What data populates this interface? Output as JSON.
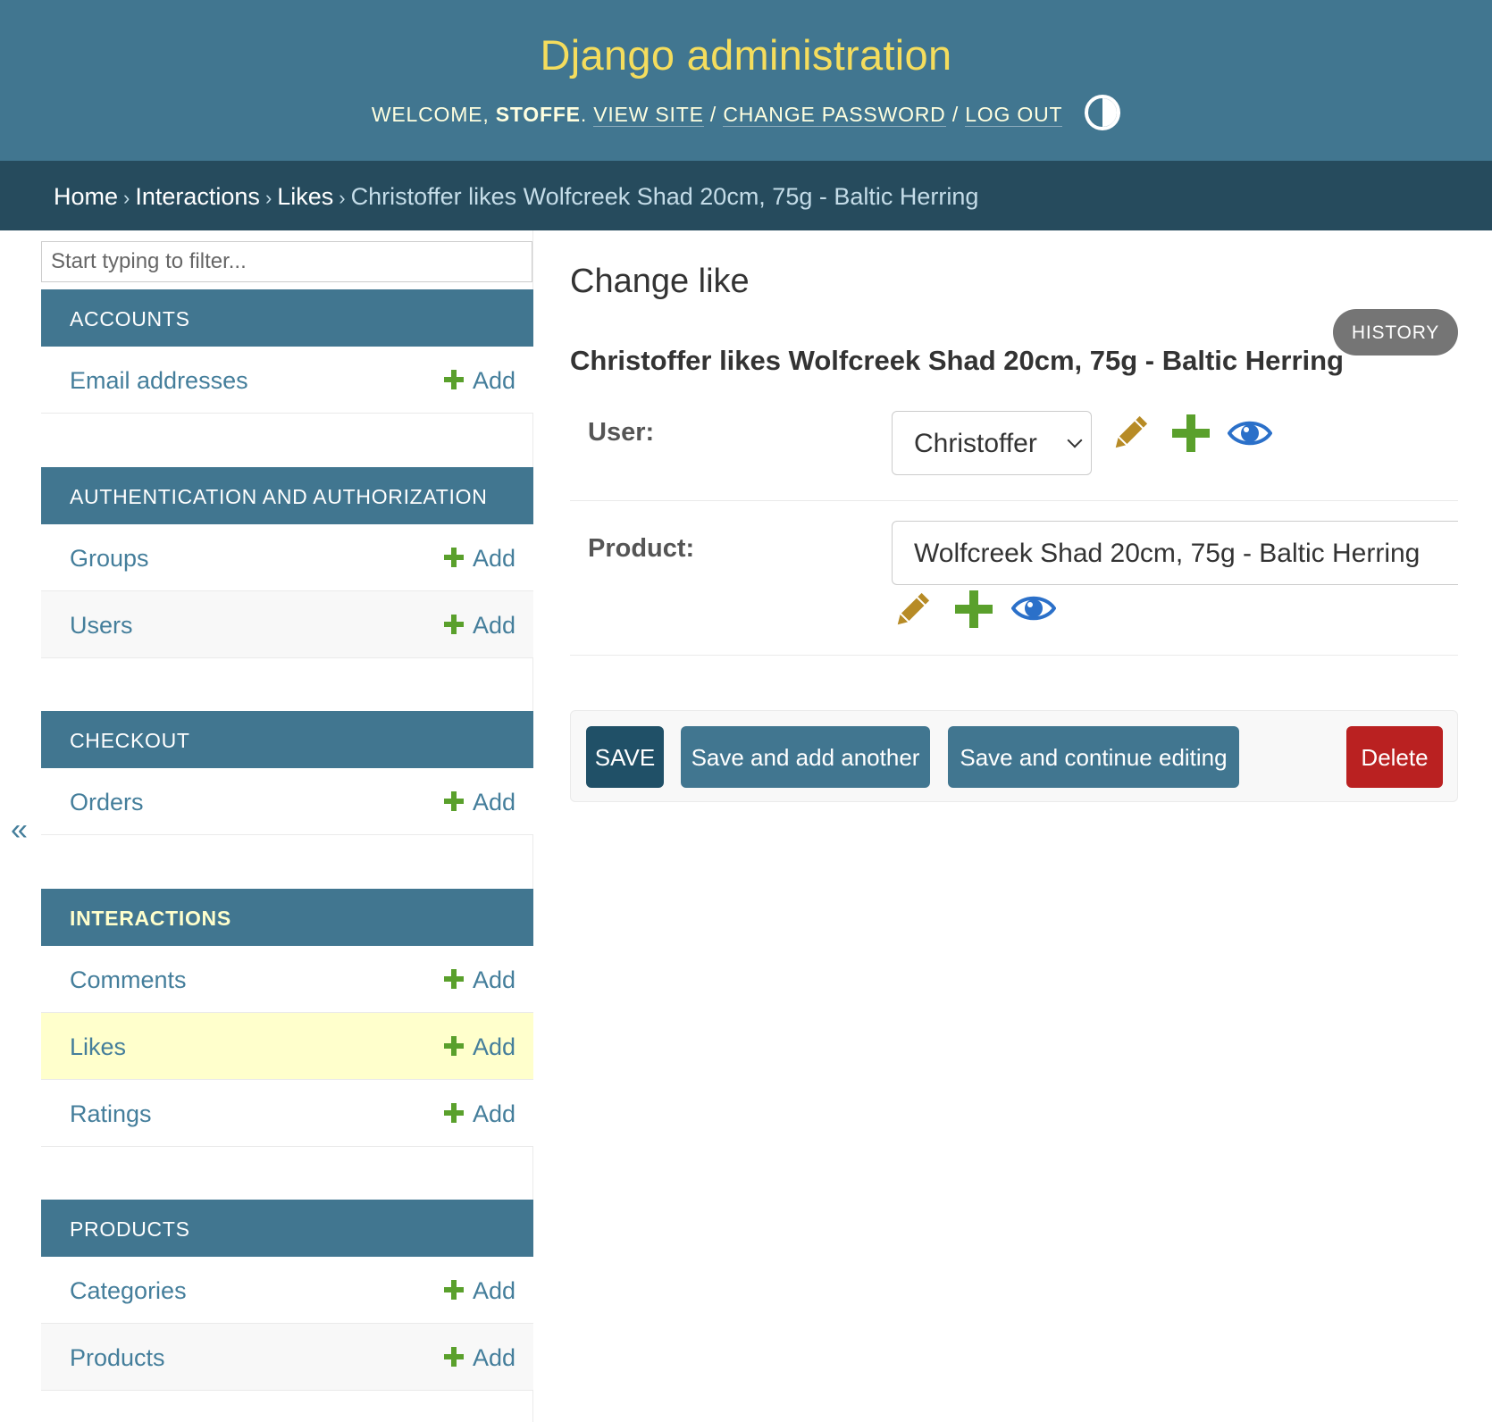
{
  "header": {
    "site_name": "Django administration",
    "welcome": "WELCOME,",
    "username": "STOFFE",
    "view_site": "VIEW SITE",
    "change_password": "CHANGE PASSWORD",
    "log_out": "LOG OUT",
    "separator": "/"
  },
  "breadcrumbs": {
    "home": "Home",
    "app": "Interactions",
    "model": "Likes",
    "current": "Christoffer likes Wolfcreek Shad 20cm, 75g - Baltic Herring",
    "separator": "›"
  },
  "sidebar": {
    "filter_placeholder": "Start typing to filter...",
    "toggle_label": "«",
    "add_label": "Add",
    "modules": [
      {
        "caption": "ACCOUNTS",
        "models": [
          "Email addresses"
        ]
      },
      {
        "caption": "AUTHENTICATION AND AUTHORIZATION",
        "models": [
          "Groups",
          "Users"
        ]
      },
      {
        "caption": "CHECKOUT",
        "models": [
          "Orders"
        ]
      },
      {
        "caption": "INTERACTIONS",
        "current": true,
        "models": [
          "Comments",
          "Likes",
          "Ratings"
        ]
      },
      {
        "caption": "PRODUCTS",
        "models": [
          "Categories",
          "Products"
        ]
      }
    ]
  },
  "content": {
    "title": "Change like",
    "history": "HISTORY",
    "object_title": "Christoffer likes Wolfcreek Shad 20cm, 75g - Baltic Herring",
    "fields": {
      "user": {
        "label": "User:",
        "value": "Christoffer"
      },
      "product": {
        "label": "Product:",
        "value": "Wolfcreek Shad 20cm, 75g - Baltic Herring"
      }
    },
    "buttons": {
      "save": "SAVE",
      "save_add": "Save and add another",
      "save_continue": "Save and continue editing",
      "delete": "Delete"
    }
  },
  "icons": [
    "contrast-toggle-icon",
    "pencil-icon",
    "plus-icon",
    "eye-icon"
  ],
  "colors": {
    "header_bg": "#417690",
    "breadcrumb_bg": "#264b5d",
    "site_name": "#f5dd5d",
    "link": "#447e9b",
    "current_row": "#ffffcc",
    "add_green": "#5aa02c",
    "pencil": "#b78b26",
    "eye": "#2b70c9",
    "delete": "#ba2121",
    "save": "#205067"
  }
}
